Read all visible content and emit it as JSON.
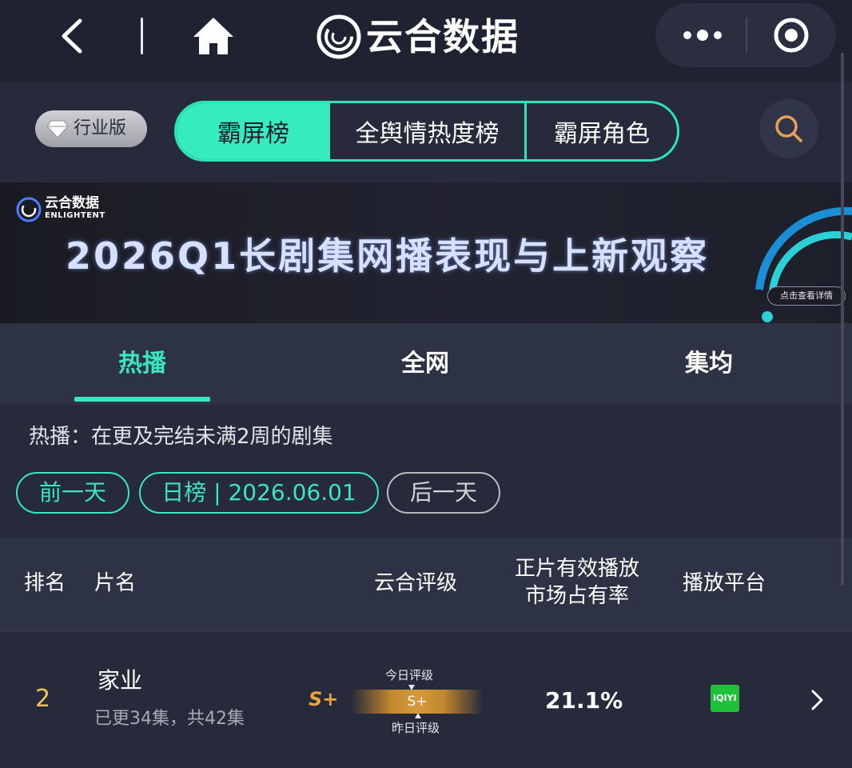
{
  "nav": {
    "title": "云合数据"
  },
  "filter": {
    "industry_badge": "行业版",
    "segments": [
      "霸屏榜",
      "全舆情热度榜",
      "霸屏角色"
    ],
    "active_segment": "霸屏榜"
  },
  "banner": {
    "brand_cn": "云合数据",
    "brand_en": "ENLIGHTENT",
    "title": "2026Q1长剧集网播表现与上新观察",
    "detail_button": "点击查看详情"
  },
  "tabs": {
    "items": [
      "热播",
      "全网",
      "集均"
    ],
    "active": "热播"
  },
  "info": {
    "description": "热播：在更及完结未满2周的剧集",
    "prev_day": "前一天",
    "date_label": "日榜 | 2026.06.01",
    "next_day": "后一天"
  },
  "table": {
    "headers": {
      "rank": "排名",
      "name": "片名",
      "grade": "云合评级",
      "share": "正片有效播放市场占有率",
      "platform": "播放平台"
    },
    "rows": [
      {
        "rank": "2",
        "title": "家业",
        "subtitle": "已更34集，共42集",
        "grade": "S+",
        "today_label": "今日评级",
        "today_grade": "S+",
        "yesterday_label": "昨日评级",
        "share": "21.1%",
        "platform": "iQIYI"
      }
    ]
  },
  "colors": {
    "accent": "#34ecbe",
    "rank_gold": "#f2c25a",
    "grade_orange": "#e8a53c",
    "iqiyi_green": "#1fc03a"
  },
  "icons": [
    "back-icon",
    "home-icon",
    "app-logo-icon",
    "more-icon",
    "close-circle-icon",
    "diamond-icon",
    "search-icon",
    "chevron-right-icon"
  ]
}
